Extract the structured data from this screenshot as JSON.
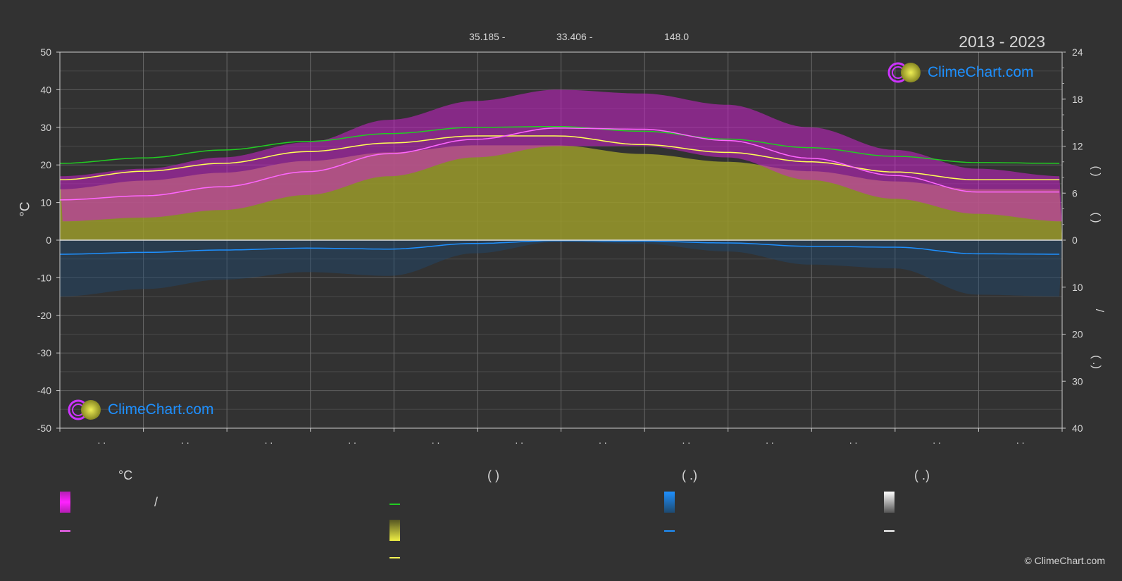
{
  "header": {
    "stat1": "35.185 -",
    "stat2": "33.406 -",
    "stat3": "148.0",
    "period": "2013 - 2023"
  },
  "logo": {
    "text": "ClimeChart.com"
  },
  "copyright": "© ClimeChart.com",
  "colors": {
    "background": "#323232",
    "temp_band": "#d21ed2",
    "sunshine_band": "#b4b42d",
    "precip_band": "#1e5a8c",
    "daylight_line": "#22cc22",
    "sunshine_line": "#ffff55",
    "temp_line": "#ff66ff",
    "precip_line": "#1e90ff",
    "snow_line": "#ffffff"
  },
  "chart_data": {
    "type": "area",
    "title": "",
    "left_axis": {
      "label": "°C",
      "ticks": [
        "50",
        "40",
        "30",
        "20",
        "10",
        "0",
        "-10",
        "-20",
        "-30",
        "-40",
        "-50"
      ],
      "range": [
        -50,
        50
      ]
    },
    "right_axis_top": {
      "ticks": [
        "24",
        "18",
        "12",
        "6",
        "0"
      ],
      "range": [
        0,
        24
      ]
    },
    "right_axis_bottom": {
      "ticks": [
        "10",
        "20",
        "30",
        "40"
      ],
      "range": [
        0,
        40
      ]
    },
    "right_axis_labels": [
      "(   )",
      "(   )",
      "/",
      "(   .)"
    ],
    "x_labels": [
      ". .",
      ". .",
      ". .",
      ". .",
      ". .",
      ". .",
      ". .",
      ". .",
      ". .",
      ". .",
      ". .",
      ". ."
    ],
    "x_range": [
      0,
      365
    ],
    "series": [
      {
        "key": "daylight",
        "axis": "hours",
        "x": [
          0,
          31,
          59,
          90,
          120,
          151,
          181,
          212,
          243,
          273,
          304,
          334,
          365
        ],
        "values": [
          9.8,
          10.5,
          11.5,
          12.6,
          13.6,
          14.4,
          14.5,
          13.9,
          12.9,
          11.8,
          10.7,
          9.9,
          9.8
        ]
      },
      {
        "key": "sunshine",
        "axis": "hours",
        "x": [
          0,
          31,
          59,
          90,
          120,
          151,
          181,
          212,
          243,
          273,
          304,
          334,
          365
        ],
        "values": [
          7.7,
          8.8,
          9.8,
          11.3,
          12.4,
          13.3,
          13.3,
          12.2,
          11.2,
          10.0,
          8.7,
          7.7,
          7.7
        ]
      },
      {
        "key": "temp_mean",
        "axis": "temp",
        "x": [
          0,
          31,
          59,
          90,
          120,
          151,
          181,
          212,
          243,
          273,
          304,
          334,
          365
        ],
        "values": [
          10.7,
          11.8,
          14.2,
          18.2,
          23.0,
          26.8,
          29.8,
          29.5,
          26.5,
          21.8,
          17.2,
          12.8,
          12.8
        ]
      },
      {
        "key": "precipitation",
        "axis": "precip",
        "x": [
          0,
          31,
          59,
          90,
          120,
          151,
          181,
          212,
          243,
          273,
          304,
          334,
          365
        ],
        "values": [
          3.0,
          2.6,
          2.1,
          1.7,
          1.9,
          0.7,
          0.1,
          0.2,
          0.6,
          1.3,
          1.5,
          2.9,
          3.0
        ]
      },
      {
        "key": "temp_band_min",
        "axis": "temp",
        "x": [
          0,
          31,
          59,
          90,
          120,
          151,
          181,
          212,
          243,
          273,
          304,
          334,
          365
        ],
        "values": [
          5,
          6,
          8,
          12,
          17,
          22,
          25,
          25,
          22,
          16,
          11,
          7,
          5
        ]
      },
      {
        "key": "temp_band_max",
        "axis": "temp",
        "x": [
          0,
          31,
          59,
          90,
          120,
          151,
          181,
          212,
          243,
          273,
          304,
          334,
          365
        ],
        "values": [
          17,
          19,
          22,
          26,
          32,
          37,
          40,
          39,
          36,
          30,
          24,
          19,
          17
        ]
      }
    ]
  },
  "legend": {
    "col1": {
      "head": "°C",
      "item1_sep": "/"
    },
    "col2": {
      "head": "(          )"
    },
    "col3": {
      "head": "(   .)"
    },
    "col4": {
      "head": "(   .)"
    }
  }
}
